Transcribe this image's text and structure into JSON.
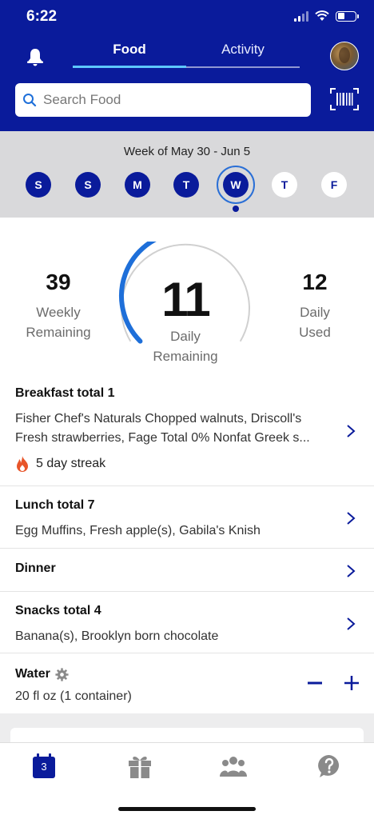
{
  "status": {
    "time": "6:22"
  },
  "tabs": {
    "food": "Food",
    "activity": "Activity"
  },
  "search": {
    "placeholder": "Search Food"
  },
  "week": {
    "label": "Week of May 30 - Jun 5",
    "days": [
      "S",
      "S",
      "M",
      "T",
      "W",
      "T",
      "F"
    ],
    "selected_index": 4
  },
  "points": {
    "weekly_value": "39",
    "weekly_label_1": "Weekly",
    "weekly_label_2": "Remaining",
    "daily_value": "11",
    "daily_label_1": "Daily",
    "daily_label_2": "Remaining",
    "used_value": "12",
    "used_label_1": "Daily",
    "used_label_2": "Used",
    "gauge_remaining_fraction": 0.48
  },
  "meals": {
    "breakfast": {
      "title": "Breakfast total  1",
      "line1": "Fisher Chef's Naturals Chopped walnuts, Driscoll's",
      "line2": "Fresh strawberries, Fage Total 0% Nonfat Greek s...",
      "streak": "5 day streak"
    },
    "lunch": {
      "title": "Lunch total  7",
      "desc": "Egg Muffins, Fresh apple(s), Gabila's Knish"
    },
    "dinner": {
      "title": "Dinner"
    },
    "snacks": {
      "title": "Snacks total  4",
      "desc": "Banana(s), Brooklyn born chocolate"
    }
  },
  "water": {
    "title": "Water",
    "amount": "20 fl oz (1 container)"
  },
  "nav": {
    "calendar_day": "3"
  },
  "colors": {
    "brand": "#0a1b9b",
    "accent": "#1e6fd9",
    "tab_indicator": "#5ec8ff"
  },
  "icons": [
    "bell-icon",
    "search-icon",
    "barcode-icon",
    "flame-icon",
    "gear-icon",
    "calendar-icon",
    "gift-icon",
    "community-icon",
    "help-icon"
  ]
}
